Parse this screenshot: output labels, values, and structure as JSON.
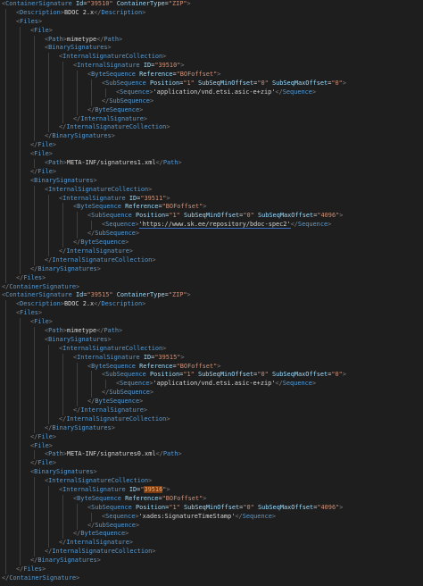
{
  "editor": {
    "language": "xml",
    "theme_colors": {
      "background": "#1e1e1e",
      "bracket": "#808080",
      "tag": "#569cd6",
      "attribute": "#9cdcfe",
      "string": "#ce9178",
      "text": "#d4d4d4",
      "highlight": "#613214"
    },
    "lines": [
      {
        "i": 0,
        "t": [
          [
            "o",
            "ContainerSignature"
          ],
          [
            "a",
            "Id"
          ],
          [
            "v",
            "39510"
          ],
          [
            "a",
            "ContainerType"
          ],
          [
            "v",
            "ZIP"
          ],
          [
            "e",
            ">"
          ]
        ]
      },
      {
        "i": 1,
        "t": [
          [
            "o",
            "Description"
          ],
          [
            "e",
            ">"
          ],
          [
            "x",
            "BDOC 2.x"
          ],
          [
            "c",
            "Description"
          ]
        ]
      },
      {
        "i": 1,
        "t": [
          [
            "o",
            "Files"
          ],
          [
            "e",
            ">"
          ]
        ]
      },
      {
        "i": 2,
        "t": [
          [
            "o",
            "File"
          ],
          [
            "e",
            ">"
          ]
        ]
      },
      {
        "i": 3,
        "t": [
          [
            "o",
            "Path"
          ],
          [
            "e",
            ">"
          ],
          [
            "x",
            "mimetype"
          ],
          [
            "c",
            "Path"
          ]
        ]
      },
      {
        "i": 3,
        "t": [
          [
            "o",
            "BinarySignatures"
          ],
          [
            "e",
            ">"
          ]
        ]
      },
      {
        "i": 4,
        "t": [
          [
            "o",
            "InternalSignatureCollection"
          ],
          [
            "e",
            ">"
          ]
        ]
      },
      {
        "i": 5,
        "t": [
          [
            "o",
            "InternalSignature"
          ],
          [
            "a",
            "ID"
          ],
          [
            "v",
            "39510"
          ],
          [
            "e",
            ">"
          ]
        ]
      },
      {
        "i": 6,
        "t": [
          [
            "o",
            "ByteSequence"
          ],
          [
            "a",
            "Reference"
          ],
          [
            "v",
            "BOFoffset"
          ],
          [
            "e",
            ">"
          ]
        ]
      },
      {
        "i": 7,
        "t": [
          [
            "o",
            "SubSequence"
          ],
          [
            "a",
            "Position"
          ],
          [
            "v",
            "1"
          ],
          [
            "a",
            "SubSeqMinOffset"
          ],
          [
            "v",
            "0"
          ],
          [
            "a",
            "SubSeqMaxOffset"
          ],
          [
            "v",
            "0"
          ],
          [
            "e",
            ">"
          ]
        ]
      },
      {
        "i": 8,
        "t": [
          [
            "o",
            "Sequence"
          ],
          [
            "e",
            ">"
          ],
          [
            "x",
            "'application/vnd.etsi.asic-e+zip'"
          ],
          [
            "c",
            "Sequence"
          ]
        ]
      },
      {
        "i": 7,
        "t": [
          [
            "c",
            "SubSequence"
          ]
        ]
      },
      {
        "i": 6,
        "t": [
          [
            "c",
            "ByteSequence"
          ]
        ]
      },
      {
        "i": 5,
        "t": [
          [
            "c",
            "InternalSignature"
          ]
        ]
      },
      {
        "i": 4,
        "t": [
          [
            "c",
            "InternalSignatureCollection"
          ]
        ]
      },
      {
        "i": 3,
        "t": [
          [
            "c",
            "BinarySignatures"
          ]
        ]
      },
      {
        "i": 2,
        "t": [
          [
            "c",
            "File"
          ]
        ]
      },
      {
        "i": 2,
        "t": [
          [
            "o",
            "File"
          ],
          [
            "e",
            ">"
          ]
        ]
      },
      {
        "i": 3,
        "t": [
          [
            "o",
            "Path"
          ],
          [
            "e",
            ">"
          ],
          [
            "x",
            "META-INF/signatures1.xml"
          ],
          [
            "c",
            "Path"
          ]
        ]
      },
      {
        "i": 2,
        "t": [
          [
            "c",
            "File"
          ]
        ]
      },
      {
        "i": 2,
        "t": [
          [
            "o",
            "BinarySignatures"
          ],
          [
            "e",
            ">"
          ]
        ]
      },
      {
        "i": 3,
        "t": [
          [
            "o",
            "InternalSignatureCollection"
          ],
          [
            "e",
            ">"
          ]
        ]
      },
      {
        "i": 4,
        "t": [
          [
            "o",
            "InternalSignature"
          ],
          [
            "a",
            "ID"
          ],
          [
            "v",
            "39511"
          ],
          [
            "e",
            ">"
          ]
        ]
      },
      {
        "i": 5,
        "t": [
          [
            "o",
            "ByteSequence"
          ],
          [
            "a",
            "Reference"
          ],
          [
            "v",
            "BOFoffset"
          ],
          [
            "e",
            ">"
          ]
        ]
      },
      {
        "i": 6,
        "t": [
          [
            "o",
            "SubSequence"
          ],
          [
            "a",
            "Position"
          ],
          [
            "v",
            "1"
          ],
          [
            "a",
            "SubSeqMinOffset"
          ],
          [
            "v",
            "0"
          ],
          [
            "a",
            "SubSeqMaxOffset"
          ],
          [
            "v",
            "4096"
          ],
          [
            "e",
            ">"
          ]
        ]
      },
      {
        "i": 7,
        "t": [
          [
            "o",
            "Sequence"
          ],
          [
            "e",
            ">"
          ],
          [
            "xu",
            "'https://www.sk.ee/repository/bdoc-spec2'"
          ],
          [
            "c",
            "Sequence"
          ]
        ]
      },
      {
        "i": 6,
        "t": [
          [
            "c",
            "SubSequence"
          ]
        ]
      },
      {
        "i": 5,
        "t": [
          [
            "c",
            "ByteSequence"
          ]
        ]
      },
      {
        "i": 4,
        "t": [
          [
            "c",
            "InternalSignature"
          ]
        ]
      },
      {
        "i": 3,
        "t": [
          [
            "c",
            "InternalSignatureCollection"
          ]
        ]
      },
      {
        "i": 2,
        "t": [
          [
            "c",
            "BinarySignatures"
          ]
        ]
      },
      {
        "i": 1,
        "t": [
          [
            "c",
            "Files"
          ]
        ]
      },
      {
        "i": 0,
        "t": [
          [
            "c",
            "ContainerSignature"
          ]
        ]
      },
      {
        "i": 0,
        "t": [
          [
            "o",
            "ContainerSignature"
          ],
          [
            "a",
            "Id"
          ],
          [
            "v",
            "39515"
          ],
          [
            "a",
            "ContainerType"
          ],
          [
            "v",
            "ZIP"
          ],
          [
            "e",
            ">"
          ]
        ]
      },
      {
        "i": 1,
        "t": [
          [
            "o",
            "Description"
          ],
          [
            "e",
            ">"
          ],
          [
            "x",
            "BDOC 2.x"
          ],
          [
            "c",
            "Description"
          ]
        ]
      },
      {
        "i": 1,
        "t": [
          [
            "o",
            "Files"
          ],
          [
            "e",
            ">"
          ]
        ]
      },
      {
        "i": 2,
        "t": [
          [
            "o",
            "File"
          ],
          [
            "e",
            ">"
          ]
        ]
      },
      {
        "i": 3,
        "t": [
          [
            "o",
            "Path"
          ],
          [
            "e",
            ">"
          ],
          [
            "x",
            "mimetype"
          ],
          [
            "c",
            "Path"
          ]
        ]
      },
      {
        "i": 3,
        "t": [
          [
            "o",
            "BinarySignatures"
          ],
          [
            "e",
            ">"
          ]
        ]
      },
      {
        "i": 4,
        "t": [
          [
            "o",
            "InternalSignatureCollection"
          ],
          [
            "e",
            ">"
          ]
        ]
      },
      {
        "i": 5,
        "t": [
          [
            "o",
            "InternalSignature"
          ],
          [
            "a",
            "ID"
          ],
          [
            "v",
            "39515"
          ],
          [
            "e",
            ">"
          ]
        ]
      },
      {
        "i": 6,
        "t": [
          [
            "o",
            "ByteSequence"
          ],
          [
            "a",
            "Reference"
          ],
          [
            "v",
            "BOFoffset"
          ],
          [
            "e",
            ">"
          ]
        ]
      },
      {
        "i": 7,
        "t": [
          [
            "o",
            "SubSequence"
          ],
          [
            "a",
            "Position"
          ],
          [
            "v",
            "1"
          ],
          [
            "a",
            "SubSeqMinOffset"
          ],
          [
            "v",
            "0"
          ],
          [
            "a",
            "SubSeqMaxOffset"
          ],
          [
            "v",
            "0"
          ],
          [
            "e",
            ">"
          ]
        ]
      },
      {
        "i": 8,
        "t": [
          [
            "o",
            "Sequence"
          ],
          [
            "e",
            ">"
          ],
          [
            "x",
            "'application/vnd.etsi.asic-e+zip'"
          ],
          [
            "c",
            "Sequence"
          ]
        ]
      },
      {
        "i": 7,
        "t": [
          [
            "c",
            "SubSequence"
          ]
        ]
      },
      {
        "i": 6,
        "t": [
          [
            "c",
            "ByteSequence"
          ]
        ]
      },
      {
        "i": 5,
        "t": [
          [
            "c",
            "InternalSignature"
          ]
        ]
      },
      {
        "i": 4,
        "t": [
          [
            "c",
            "InternalSignatureCollection"
          ]
        ]
      },
      {
        "i": 3,
        "t": [
          [
            "c",
            "BinarySignatures"
          ]
        ]
      },
      {
        "i": 2,
        "t": [
          [
            "c",
            "File"
          ]
        ]
      },
      {
        "i": 2,
        "t": [
          [
            "o",
            "File"
          ],
          [
            "e",
            ">"
          ]
        ]
      },
      {
        "i": 3,
        "t": [
          [
            "o",
            "Path"
          ],
          [
            "e",
            ">"
          ],
          [
            "x",
            "META-INF/signatures0.xml"
          ],
          [
            "c",
            "Path"
          ]
        ]
      },
      {
        "i": 2,
        "t": [
          [
            "c",
            "File"
          ]
        ]
      },
      {
        "i": 2,
        "t": [
          [
            "o",
            "BinarySignatures"
          ],
          [
            "e",
            ">"
          ]
        ]
      },
      {
        "i": 3,
        "t": [
          [
            "o",
            "InternalSignatureCollection"
          ],
          [
            "e",
            ">"
          ]
        ]
      },
      {
        "i": 4,
        "t": [
          [
            "o",
            "InternalSignature"
          ],
          [
            "a",
            "ID"
          ],
          [
            "vh",
            "39516"
          ],
          [
            "e",
            ">"
          ]
        ]
      },
      {
        "i": 5,
        "t": [
          [
            "o",
            "ByteSequence"
          ],
          [
            "a",
            "Reference"
          ],
          [
            "v",
            "BOFoffset"
          ],
          [
            "e",
            ">"
          ]
        ]
      },
      {
        "i": 6,
        "t": [
          [
            "o",
            "SubSequence"
          ],
          [
            "a",
            "Position"
          ],
          [
            "v",
            "1"
          ],
          [
            "a",
            "SubSeqMinOffset"
          ],
          [
            "v",
            "0"
          ],
          [
            "a",
            "SubSeqMaxOffset"
          ],
          [
            "v",
            "4096"
          ],
          [
            "e",
            ">"
          ]
        ]
      },
      {
        "i": 7,
        "t": [
          [
            "o",
            "Sequence"
          ],
          [
            "e",
            ">"
          ],
          [
            "x",
            "'xades:SignatureTimeStamp'"
          ],
          [
            "c",
            "Sequence"
          ]
        ]
      },
      {
        "i": 6,
        "t": [
          [
            "c",
            "SubSequence"
          ]
        ]
      },
      {
        "i": 5,
        "t": [
          [
            "c",
            "ByteSequence"
          ]
        ]
      },
      {
        "i": 4,
        "t": [
          [
            "c",
            "InternalSignature"
          ]
        ]
      },
      {
        "i": 3,
        "t": [
          [
            "c",
            "InternalSignatureCollection"
          ]
        ]
      },
      {
        "i": 2,
        "t": [
          [
            "c",
            "BinarySignatures"
          ]
        ]
      },
      {
        "i": 1,
        "t": [
          [
            "c",
            "Files"
          ]
        ]
      },
      {
        "i": 0,
        "t": [
          [
            "c",
            "ContainerSignature"
          ]
        ]
      }
    ]
  }
}
